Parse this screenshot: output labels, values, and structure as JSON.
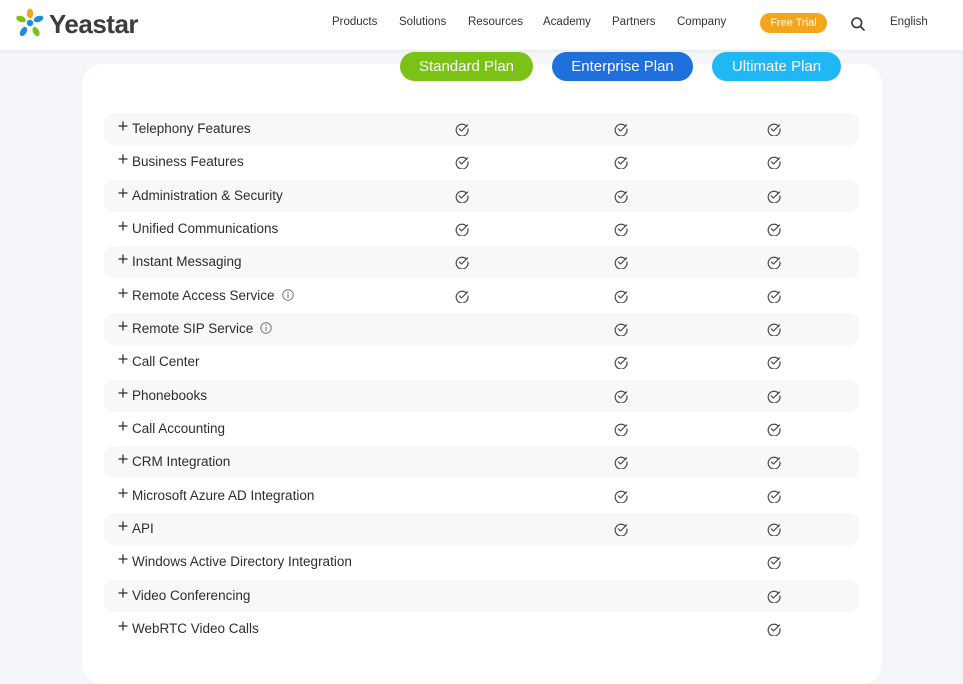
{
  "header": {
    "brand": "Yeastar",
    "logo_icon": "yeastar-logo-icon",
    "nav": [
      "Products",
      "Solutions",
      "Resources",
      "Academy",
      "Partners",
      "Company"
    ],
    "free_trial_label": "Free Trial",
    "search_icon": "search-icon",
    "language": "English"
  },
  "colors": {
    "standard": "#7ac316",
    "enterprise": "#1f6fdc",
    "ultimate": "#20b7f5",
    "free_trial": "#f4a51c",
    "check": "#4a4a4a"
  },
  "plans": [
    "Standard Plan",
    "Enterprise Plan",
    "Ultimate Plan"
  ],
  "features": [
    {
      "label": "Telephony Features",
      "info": false,
      "standard": true,
      "enterprise": true,
      "ultimate": true
    },
    {
      "label": "Business Features",
      "info": false,
      "standard": true,
      "enterprise": true,
      "ultimate": true
    },
    {
      "label": "Administration & Security",
      "info": false,
      "standard": true,
      "enterprise": true,
      "ultimate": true
    },
    {
      "label": "Unified Communications",
      "info": false,
      "standard": true,
      "enterprise": true,
      "ultimate": true
    },
    {
      "label": "Instant Messaging",
      "info": false,
      "standard": true,
      "enterprise": true,
      "ultimate": true
    },
    {
      "label": "Remote Access Service",
      "info": true,
      "standard": true,
      "enterprise": true,
      "ultimate": true
    },
    {
      "label": "Remote SIP Service",
      "info": true,
      "standard": false,
      "enterprise": true,
      "ultimate": true
    },
    {
      "label": "Call Center",
      "info": false,
      "standard": false,
      "enterprise": true,
      "ultimate": true
    },
    {
      "label": "Phonebooks",
      "info": false,
      "standard": false,
      "enterprise": true,
      "ultimate": true
    },
    {
      "label": "Call Accounting",
      "info": false,
      "standard": false,
      "enterprise": true,
      "ultimate": true
    },
    {
      "label": "CRM Integration",
      "info": false,
      "standard": false,
      "enterprise": true,
      "ultimate": true
    },
    {
      "label": "Microsoft Azure AD Integration",
      "info": false,
      "standard": false,
      "enterprise": true,
      "ultimate": true
    },
    {
      "label": "API",
      "info": false,
      "standard": false,
      "enterprise": true,
      "ultimate": true
    },
    {
      "label": "Windows Active Directory Integration",
      "info": false,
      "standard": false,
      "enterprise": false,
      "ultimate": true
    },
    {
      "label": "Video Conferencing",
      "info": false,
      "standard": false,
      "enterprise": false,
      "ultimate": true
    },
    {
      "label": "WebRTC Video Calls",
      "info": false,
      "standard": false,
      "enterprise": false,
      "ultimate": true
    }
  ]
}
